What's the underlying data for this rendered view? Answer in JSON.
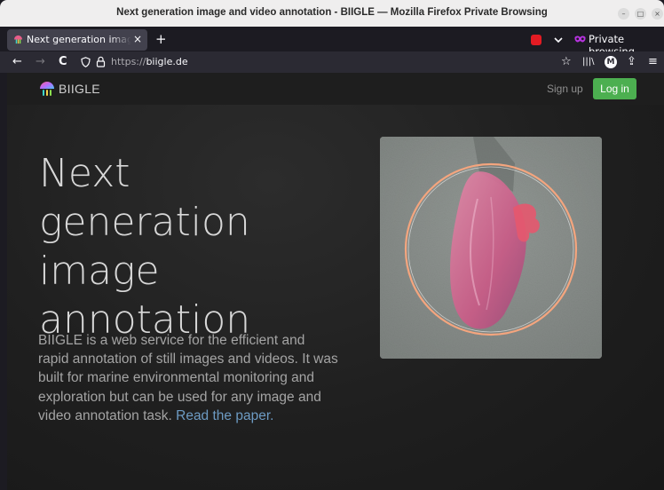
{
  "window": {
    "title": "Next generation image and video annotation - BIIGLE — Mozilla Firefox Private Browsing",
    "minimize_glyph": "–",
    "maximize_glyph": "□",
    "close_glyph": "×"
  },
  "tabs": [
    {
      "title": "Next generation image and video annotation - BIIGLE",
      "close_glyph": "×"
    }
  ],
  "new_tab_glyph": "+",
  "private_browsing": {
    "label": "Private browsing"
  },
  "navbar": {
    "back_glyph": "←",
    "forward_glyph": "→",
    "reload_glyph": "C",
    "url_scheme": "https://",
    "url_host": "biigle.de",
    "bookmark_glyph": "☆",
    "library_glyph": "|||\\",
    "account_glyph": "M",
    "extensions_glyph": "⇪",
    "menu_glyph": "≡"
  },
  "site": {
    "brand": "BIIGLE",
    "signup_label": "Sign up",
    "login_label": "Log in",
    "headline_lines": [
      "Next",
      "generation",
      "image",
      "annotation"
    ],
    "lead_text": "BIIGLE is a web service for the efficient and rapid annotation of still images and videos. It was built for marine environmental monitoring and exploration but can be used for any image and video annotation task.",
    "lead_link": "Read the paper.",
    "annotation_color": "#f4a57e",
    "accent_green": "#4caf50"
  }
}
